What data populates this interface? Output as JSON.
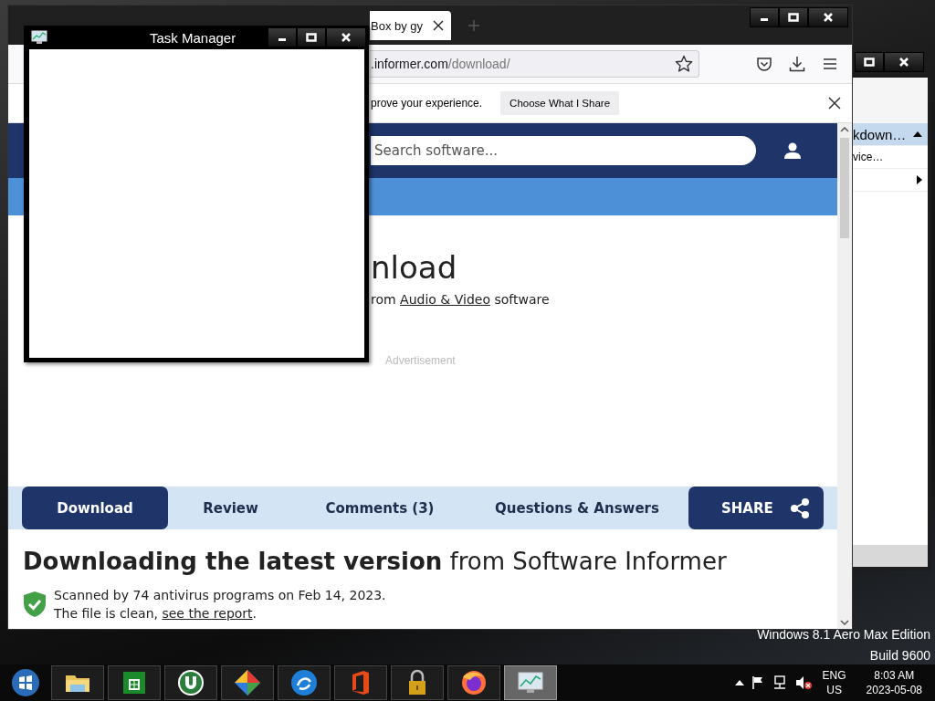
{
  "desktop": {
    "edition": "Windows 8.1 Aero Max Edition",
    "build": "Build 9600"
  },
  "background_window": {
    "items": [
      {
        "label": "kdown…",
        "selected": true
      },
      {
        "label": "vice…",
        "selected": false
      },
      {
        "kind": "submenu",
        "selected": false
      }
    ]
  },
  "browser": {
    "tab": {
      "title": "Box by gy"
    },
    "address": {
      "host": ".informer.com",
      "path": "/download/"
    },
    "notification": {
      "message": "prove your experience.",
      "button": "Choose What I Share"
    },
    "page": {
      "search": {
        "placeholder": "Search software..."
      },
      "heading": "nload",
      "subtitle": {
        "before": "rom ",
        "link": "Audio & Video",
        "after": " software"
      },
      "ad_label": "Advertisement",
      "nav_tabs": [
        {
          "label": "Download",
          "selected": true
        },
        {
          "label": "Review",
          "selected": false
        },
        {
          "label": "Comments (3)",
          "selected": false
        },
        {
          "label": "Questions & Answers",
          "selected": false
        }
      ],
      "share": "SHARE",
      "section_heading": "**Downloading the latest version** from Software Informer",
      "scan_text": "Scanned by 74 antivirus programs on Feb 14, 2023.",
      "clean": {
        "before": "The file is clean, ",
        "link": "see the report",
        "after": "."
      }
    }
  },
  "task_manager": {
    "title": "Task Manager"
  },
  "taskbar": {
    "apps": [
      {
        "kind": "start",
        "selected": false
      },
      {
        "kind": "folder",
        "selected": false
      },
      {
        "kind": "store",
        "selected": false
      },
      {
        "kind": "torrent",
        "selected": false
      },
      {
        "kind": "diamond",
        "selected": false
      },
      {
        "kind": "browser-blue",
        "selected": false
      },
      {
        "kind": "office",
        "selected": false
      },
      {
        "kind": "lock",
        "selected": false
      },
      {
        "kind": "firefox",
        "selected": false
      },
      {
        "kind": "monitor",
        "selected": true
      }
    ],
    "tray": {
      "muted": true,
      "language": "ENG",
      "region": "US",
      "time": "8:03 AM",
      "date": "2023-05-08"
    }
  }
}
